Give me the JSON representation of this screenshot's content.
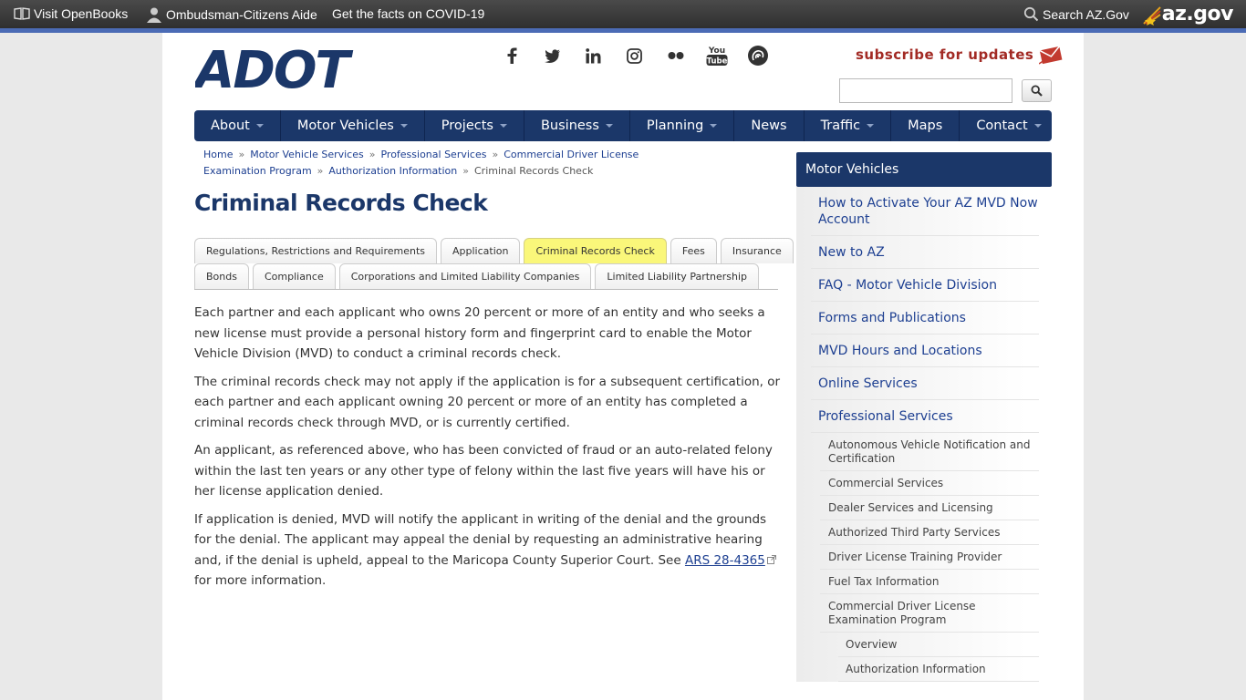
{
  "topbar": {
    "openbooks": "Visit OpenBooks",
    "ombudsman": "Ombudsman-Citizens Aide",
    "covid": "Get the facts on COVID-19",
    "search": "Search AZ.Gov",
    "azgov": "az.gov"
  },
  "header": {
    "logo": "ADOT",
    "subscribe": "subscribe for updates",
    "social": [
      "facebook-icon",
      "twitter-icon",
      "linkedin-icon",
      "instagram-icon",
      "flickr-icon",
      "youtube-icon",
      "podcast-icon"
    ],
    "youtube_text_1": "You",
    "youtube_text_2": "Tube",
    "search_placeholder": ""
  },
  "nav": [
    {
      "label": "About",
      "dropdown": true
    },
    {
      "label": "Motor Vehicles",
      "dropdown": true
    },
    {
      "label": "Projects",
      "dropdown": true
    },
    {
      "label": "Business",
      "dropdown": true
    },
    {
      "label": "Planning",
      "dropdown": true
    },
    {
      "label": "News",
      "dropdown": false
    },
    {
      "label": "Traffic",
      "dropdown": true
    },
    {
      "label": "Maps",
      "dropdown": false
    },
    {
      "label": "Contact",
      "dropdown": true
    }
  ],
  "breadcrumb": {
    "items": [
      "Home",
      "Motor Vehicle Services",
      "Professional Services",
      "Commercial Driver License Examination Program",
      "Authorization Information"
    ],
    "current": "Criminal Records Check",
    "separator": "»"
  },
  "page_title": "Criminal Records Check",
  "tabs": {
    "row1": [
      "Regulations, Restrictions and Requirements",
      "Application",
      "Criminal Records Check",
      "Fees",
      "Insurance"
    ],
    "row2": [
      "Bonds",
      "Compliance",
      "Corporations and Limited Liability Companies",
      "Limited Liability Partnership"
    ],
    "active": "Criminal Records Check"
  },
  "content": {
    "p1": "Each partner and each applicant who owns 20 percent or more of an entity and who seeks a new license must provide a personal history form and fingerprint card to enable the Motor Vehicle Division (MVD) to conduct a criminal records check.",
    "p2": "The criminal records check may not apply if the application is for a subsequent certification, or each partner and each applicant owning 20 percent or more of an entity has completed a criminal records check through MVD, or is currently certified.",
    "p3": "An applicant, as referenced above, who has been convicted of fraud or an auto-related felony within the last ten years or any other type of felony within the last five years will have his or her license application denied.",
    "p4_before": "If application is denied, MVD will notify the applicant in writing of the denial and the grounds for the denial. The applicant may appeal the denial by requesting an administrative hearing and, if the denial is upheld, appeal to the Maricopa County Superior Court. See ",
    "p4_link": "ARS 28-4365",
    "p4_after": " for more information."
  },
  "sidebar": {
    "title": "Motor Vehicles",
    "items": [
      "How to Activate Your AZ MVD Now Account",
      "New to AZ",
      "FAQ - Motor Vehicle Division",
      "Forms and Publications",
      "MVD Hours and Locations",
      "Online Services",
      "Professional Services"
    ],
    "sub_items": [
      "Autonomous Vehicle Notification and Certification",
      "Commercial Services",
      "Dealer Services and Licensing",
      "Authorized Third Party Services",
      "Driver License Training Provider",
      "Fuel Tax Information",
      "Commercial Driver License Examination Program"
    ],
    "sub_sub_items": [
      "Overview",
      "Authorization Information"
    ]
  },
  "colors": {
    "brand_navy": "#1b3769",
    "link_blue": "#1d3f91",
    "active_tab": "#faf77a",
    "subscribe_red": "#a22a24"
  }
}
